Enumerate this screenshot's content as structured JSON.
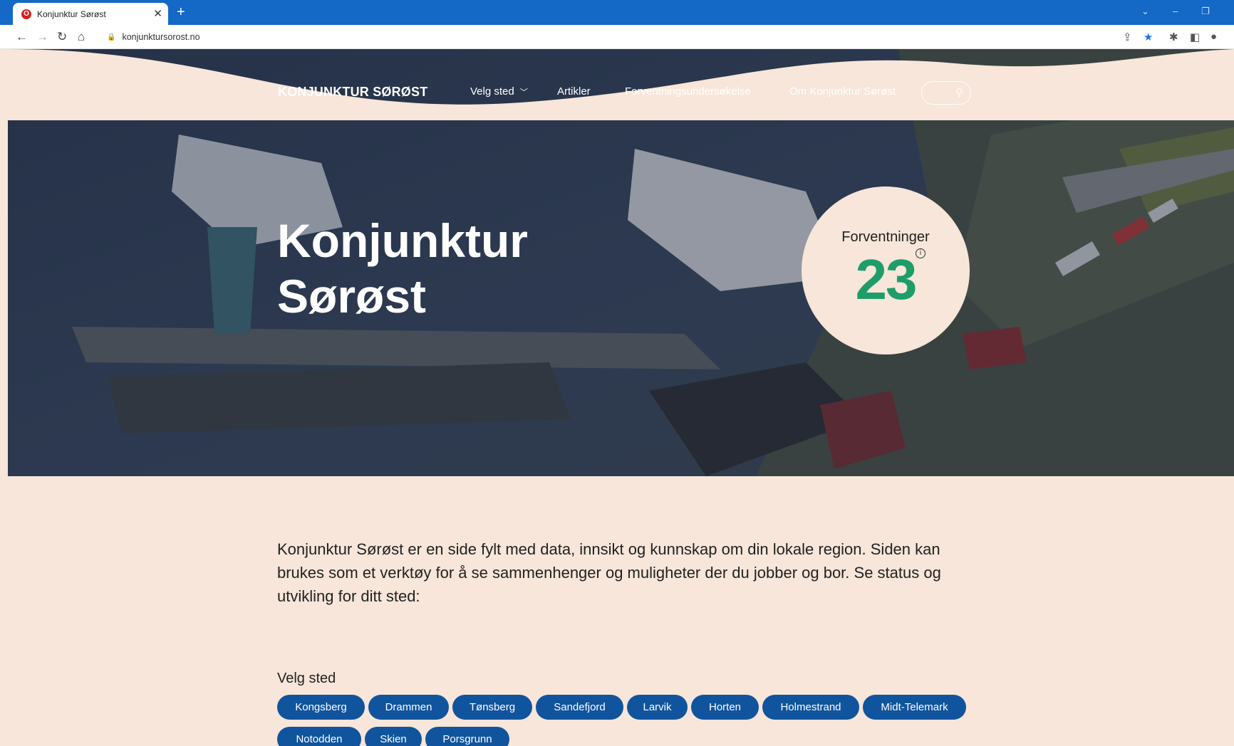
{
  "browser": {
    "tab_title": "Konjunktur Sørøst",
    "tab_favicon": "O",
    "url": "konjunktursorost.no"
  },
  "header": {
    "logo": "KONJUNKTUR SØRØST",
    "nav": [
      "Velg sted",
      "Artikler",
      "Forventningsundersøkelse",
      "Om Konjunktur Sørøst"
    ]
  },
  "hero": {
    "title_line1": "Konjunktur",
    "title_line2": "Sørøst",
    "badge_label": "Forventninger",
    "badge_value": "23"
  },
  "intro": "Konjunktur Sørøst er en side fylt med data, innsikt og kunnskap om din lokale region. Siden kan brukes som et verktøy for å se sammenhenger og muligheter der du jobber og bor. Se status og utvikling for ditt sted:",
  "places": {
    "label": "Velg sted",
    "items": [
      "Kongsberg",
      "Drammen",
      "Tønsberg",
      "Sandefjord",
      "Larvik",
      "Horten",
      "Holmestrand",
      "Midt-Telemark",
      "Notodden",
      "Skien",
      "Porsgrunn"
    ]
  },
  "colors": {
    "pill": "#10549e",
    "page_bg": "#f7e6d9",
    "number": "#1e9d6a"
  }
}
